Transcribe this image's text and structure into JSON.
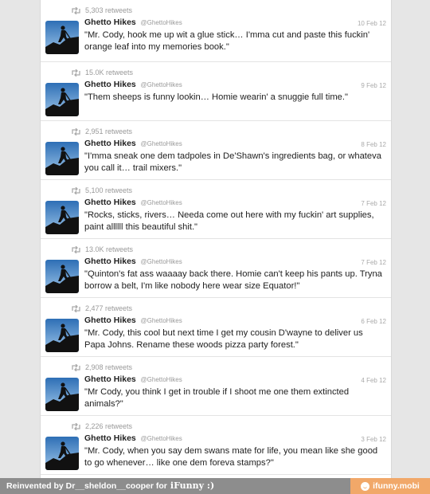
{
  "account": {
    "name": "Ghetto Hikes",
    "handle": "@GhettoHikes"
  },
  "tweets": [
    {
      "retweets": "5,303 retweets",
      "date": "10 Feb 12",
      "text": "\"Mr. Cody, hook me up wit a glue stick… I'mma cut and paste this fuckin' orange leaf into my memories book.\""
    },
    {
      "retweets": "15.0K retweets",
      "date": "9 Feb 12",
      "text": "\"Them sheeps is funny lookin… Homie wearin' a snuggie full time.\""
    },
    {
      "retweets": "2,951 retweets",
      "date": "8 Feb 12",
      "text": "\"I'mma sneak one dem tadpoles in De'Shawn's ingredients bag, or whateva you call it… trail mixers.\""
    },
    {
      "retweets": "5,100 retweets",
      "date": "7 Feb 12",
      "text": "\"Rocks, sticks, rivers… Needa come out here with my fuckin' art supplies, paint allllll this beautiful shit.\""
    },
    {
      "retweets": "13.0K retweets",
      "date": "7 Feb 12",
      "text": "\"Quinton's fat ass waaaay back there. Homie can't keep his pants up. Tryna borrow a belt, I'm like nobody here wear size Equator!\""
    },
    {
      "retweets": "2,477 retweets",
      "date": "6 Feb 12",
      "text": "\"Mr. Cody, this cool but next time I get my cousin D'wayne to deliver us Papa Johns. Rename these woods pizza party forest.\""
    },
    {
      "retweets": "2,908 retweets",
      "date": "4 Feb 12",
      "text": "\"Mr Cody, you think I get in trouble if I shoot me one them extincted animals?\""
    },
    {
      "retweets": "2,226 retweets",
      "date": "3 Feb 12",
      "text": "\"Mr. Cody, when you say dem swans mate for life, you mean like she good to go whenever… like one dem foreva stamps?\""
    }
  ],
  "footer": {
    "credit": "Reinvented by Dr__sheldon__cooper for",
    "brand": "iFunny :)",
    "site": "ifunny.mobi"
  },
  "colors": {
    "footer_bg": "#8d8d8d",
    "badge_bg": "#f1a869",
    "avatar_sky_top": "#2e6fb5",
    "avatar_sky_bottom": "#9fc6ea"
  },
  "icons": {
    "retweet": "retweet-icon",
    "avatar": "hiker-silhouette-avatar",
    "badge": "smiley-icon"
  }
}
